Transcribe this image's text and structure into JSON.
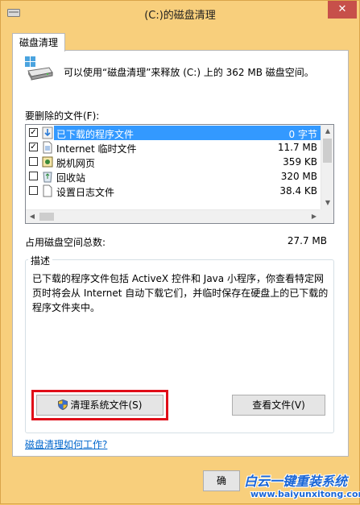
{
  "window": {
    "title": "(C:)的磁盘清理",
    "close_label": "✕"
  },
  "tab": {
    "label": "磁盘清理"
  },
  "summary": {
    "text": "可以使用“磁盘清理”来释放  (C:) 上的 362 MB 磁盘空间。"
  },
  "files": {
    "label": "要删除的文件(F):",
    "items": [
      {
        "name": "已下载的程序文件",
        "size": "0 字节",
        "checked": true,
        "selected": true,
        "icon": "folder-download-icon"
      },
      {
        "name": "Internet 临时文件",
        "size": "11.7 MB",
        "checked": true,
        "selected": false,
        "icon": "document-icon"
      },
      {
        "name": "脱机网页",
        "size": "359 KB",
        "checked": false,
        "selected": false,
        "icon": "offline-pages-icon"
      },
      {
        "name": "回收站",
        "size": "320 MB",
        "checked": false,
        "selected": false,
        "icon": "recycle-bin-icon"
      },
      {
        "name": "设置日志文件",
        "size": "38.4 KB",
        "checked": false,
        "selected": false,
        "icon": "blank-file-icon"
      }
    ]
  },
  "total": {
    "label": "占用磁盘空间总数:",
    "value": "27.7 MB"
  },
  "description": {
    "title": "描述",
    "text": "已下载的程序文件包括 ActiveX 控件和 Java 小程序，你查看特定网页时将会从 Internet 自动下载它们，并临时保存在硬盘上的已下载的程序文件夹中。"
  },
  "buttons": {
    "clean_system": "清理系统文件(S)",
    "view_files": "查看文件(V)",
    "ok": "确"
  },
  "help_link": "磁盘清理如何工作?",
  "watermark": {
    "text": "白云一键重装系统",
    "url": "www.baiyunxitong.com"
  },
  "colors": {
    "selection": "#3399ff",
    "highlight_frame": "#e00d18",
    "link": "#0066cc",
    "window_frame": "#f8cf7c"
  }
}
